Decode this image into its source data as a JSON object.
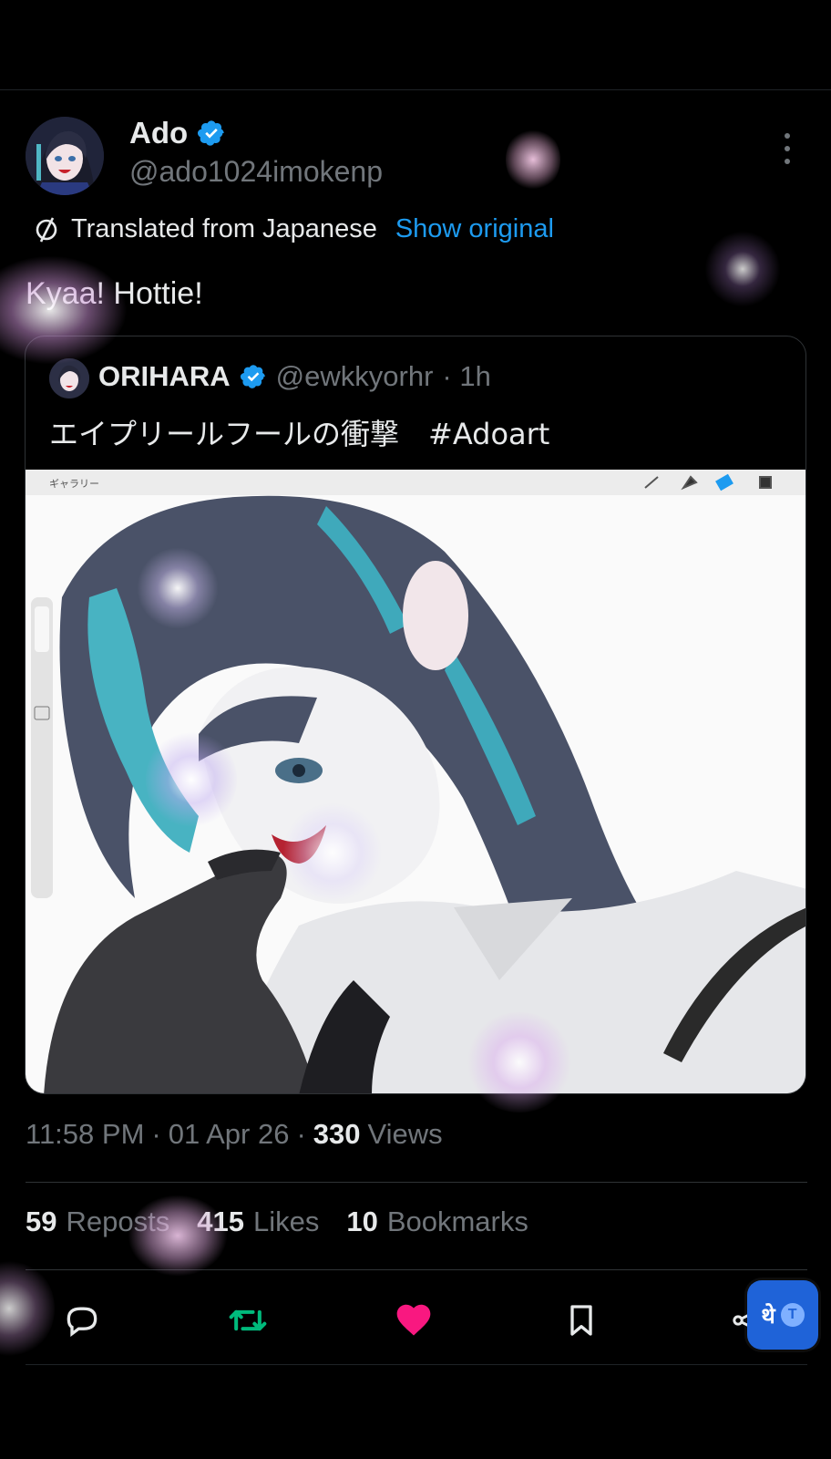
{
  "tweet": {
    "author": {
      "display_name": "Ado",
      "handle": "@ado1024imokenp",
      "verified": true
    },
    "translation": {
      "label": "Translated from Japanese",
      "action": "Show original"
    },
    "text": "Kyaa! Hottie!",
    "quote": {
      "display_name": "ORIHARA",
      "handle": "@ewkkyorhr",
      "time": "· 1h",
      "text": "エイプリールフールの衝撃　#Adoart",
      "image": {
        "app_toolbar_label": "ギャラリー"
      }
    },
    "meta": {
      "time": "11:58 PM",
      "date": "01 Apr 26",
      "views_count": "330",
      "views_label": "Views",
      "sep": "·"
    },
    "stats": {
      "reposts": {
        "count": "59",
        "label": "Reposts"
      },
      "likes": {
        "count": "415",
        "label": "Likes"
      },
      "bookmarks": {
        "count": "10",
        "label": "Bookmarks"
      }
    },
    "actions": {
      "reply": "reply-icon",
      "repost": "repost-icon",
      "like": "heart-icon",
      "bookmark": "bookmark-icon",
      "share": "share-icon"
    },
    "translate_fab": {
      "glyph": "थे",
      "badge": "T"
    }
  },
  "colors": {
    "background": "#000000",
    "text": "#e7e9ea",
    "secondary": "#71767b",
    "link": "#1d9bf0",
    "repost": "#00ba7c",
    "like": "#f91880",
    "verified": "#1d9bf0"
  }
}
